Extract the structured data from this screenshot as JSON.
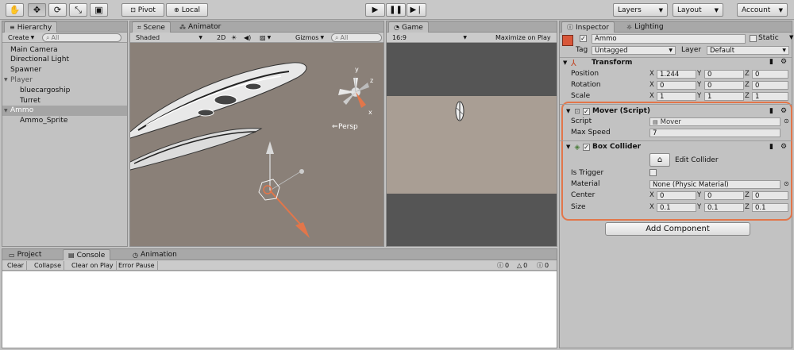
{
  "toolbar": {
    "pivot_label": "Pivot",
    "local_label": "Local",
    "layers_label": "Layers",
    "layout_label": "Layout",
    "account_label": "Account"
  },
  "hierarchy": {
    "tab_label": "Hierarchy",
    "create_label": "Create",
    "search_placeholder": "All",
    "items": [
      {
        "label": "Main Camera",
        "indent": 0
      },
      {
        "label": "Directional Light",
        "indent": 0
      },
      {
        "label": "Spawner",
        "indent": 0
      },
      {
        "label": "Player",
        "indent": 0,
        "foldout": true
      },
      {
        "label": "bluecargoship",
        "indent": 1
      },
      {
        "label": "Turret",
        "indent": 1
      },
      {
        "label": "Ammo",
        "indent": 0,
        "foldout": true,
        "selected": true
      },
      {
        "label": "Ammo_Sprite",
        "indent": 1
      }
    ]
  },
  "scene": {
    "tab_label": "Scene",
    "animator_tab_label": "Animator",
    "shaded_label": "Shaded",
    "mode_2d": "2D",
    "gizmos_label": "Gizmos",
    "search_placeholder": "All",
    "persp_label": "Persp",
    "gizmo_y": "y",
    "gizmo_z": "z",
    "gizmo_x": "x"
  },
  "game": {
    "tab_label": "Game",
    "aspect_label": "16:9",
    "maximize_label": "Maximize on Play"
  },
  "bottom": {
    "project_tab": "Project",
    "console_tab": "Console",
    "animation_tab": "Animation",
    "buttons": [
      "Clear",
      "Collapse",
      "Clear on Play",
      "Error Pause"
    ],
    "counts": [
      "0",
      "0",
      "0"
    ]
  },
  "inspector": {
    "tab_label": "Inspector",
    "lighting_tab": "Lighting",
    "object_name": "Ammo",
    "static_label": "Static",
    "tag_label": "Tag",
    "tag_value": "Untagged",
    "layer_label": "Layer",
    "layer_value": "Default",
    "transform": {
      "title": "Transform",
      "rows": [
        {
          "label": "Position",
          "x": "1.244",
          "y": "0",
          "z": "0"
        },
        {
          "label": "Rotation",
          "x": "0",
          "y": "0",
          "z": "0"
        },
        {
          "label": "Scale",
          "x": "1",
          "y": "1",
          "z": "1"
        }
      ]
    },
    "mover": {
      "title": "Mover (Script)",
      "script_label": "Script",
      "script_value": "Mover",
      "maxspeed_label": "Max Speed",
      "maxspeed_value": "7"
    },
    "box_collider": {
      "title": "Box Collider",
      "edit_label": "Edit Collider",
      "is_trigger_label": "Is Trigger",
      "material_label": "Material",
      "material_value": "None (Physic Material)",
      "center_label": "Center",
      "center": {
        "x": "0",
        "y": "0",
        "z": "0"
      },
      "size_label": "Size",
      "size": {
        "x": "0.1",
        "y": "0.1",
        "z": "0.1"
      }
    },
    "add_component_label": "Add Component",
    "axis_x": "X",
    "axis_y": "Y",
    "axis_z": "Z"
  },
  "colors": {
    "highlight": "#e2764a",
    "scene_bg": "#8a8078",
    "game_bg": "#555555",
    "game_band": "#a99e94"
  }
}
